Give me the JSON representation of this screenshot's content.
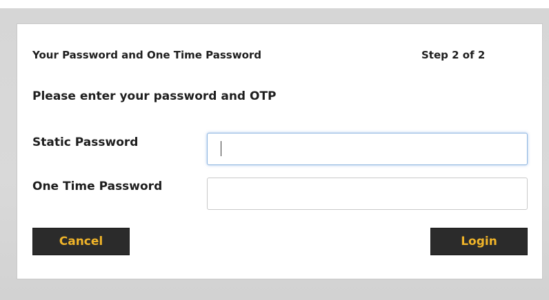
{
  "header": {
    "title": "Your Password and One Time Password",
    "step": "Step 2 of 2"
  },
  "instruction": "Please enter your password and OTP",
  "fields": {
    "static_password": {
      "label": "Static Password",
      "value": "",
      "focused": true
    },
    "one_time_password": {
      "label": "One Time Password",
      "value": ""
    }
  },
  "buttons": {
    "cancel_label": "Cancel",
    "login_label": "Login"
  },
  "colors": {
    "button_background": "#2b2b2b",
    "button_text": "#f0b429",
    "focus_border": "#8eb6e0",
    "page_background": "#d6d6d6"
  }
}
